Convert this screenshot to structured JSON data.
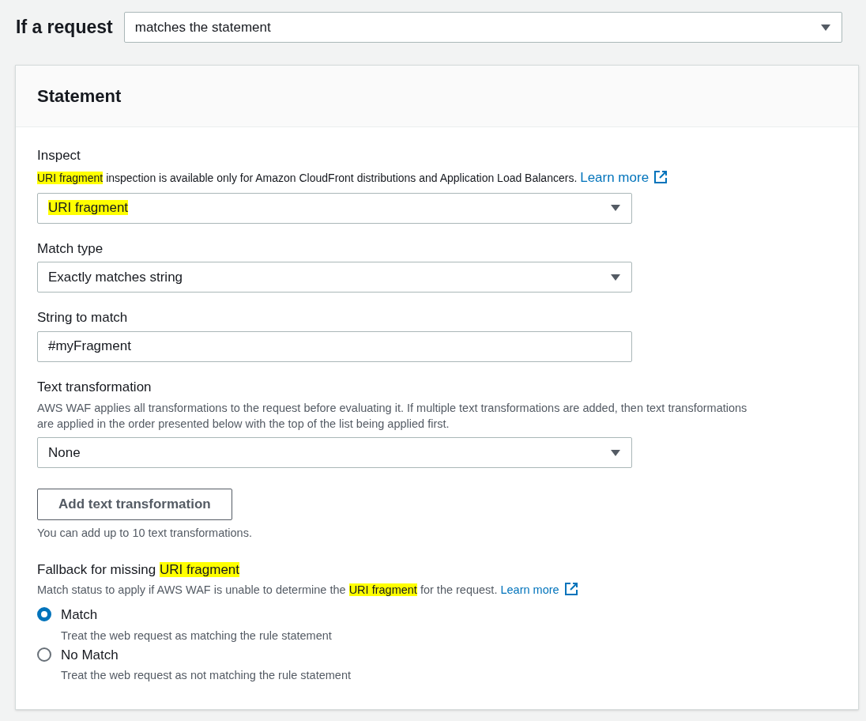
{
  "condition": {
    "label": "If a request",
    "value": "matches the statement"
  },
  "statement": {
    "title": "Statement",
    "inspect": {
      "label": "Inspect",
      "description": [
        {
          "text": "URI fragment",
          "highlighted": true
        },
        {
          "text": " inspection is available only for Amazon CloudFront distributions and Application Load Balancers.",
          "highlighted": false
        }
      ],
      "link": "Learn more",
      "value": [
        {
          "text": "URI fragment",
          "highlighted": true
        }
      ]
    },
    "match_type": {
      "label": "Match type",
      "value": "Exactly matches string"
    },
    "string_to_match": {
      "label": "String to match",
      "value": "#myFragment"
    },
    "text_transformation": {
      "label": "Text transformation",
      "description": "AWS WAF applies all transformations to the request before evaluating it. If multiple text transformations are added, then text transformations are applied in the order presented below with the top of the list being applied first.",
      "value": "None",
      "button": "Add text transformation",
      "hint": "You can add up to 10 text transformations."
    },
    "fallback": {
      "label": [
        {
          "text": "Fallback for missing ",
          "highlighted": false
        },
        {
          "text": "URI fragment",
          "highlighted": true
        }
      ],
      "description": [
        {
          "text": "Match status to apply if AWS WAF is unable to determine the ",
          "highlighted": false
        },
        {
          "text": "URI fragment",
          "highlighted": true
        },
        {
          "text": " for the request.",
          "highlighted": false
        }
      ],
      "link": "Learn more",
      "options": [
        {
          "label": "Match",
          "description": "Treat the web request as matching the rule statement",
          "selected": true
        },
        {
          "label": "No Match",
          "description": "Treat the web request as not matching the rule statement",
          "selected": false
        }
      ]
    }
  }
}
